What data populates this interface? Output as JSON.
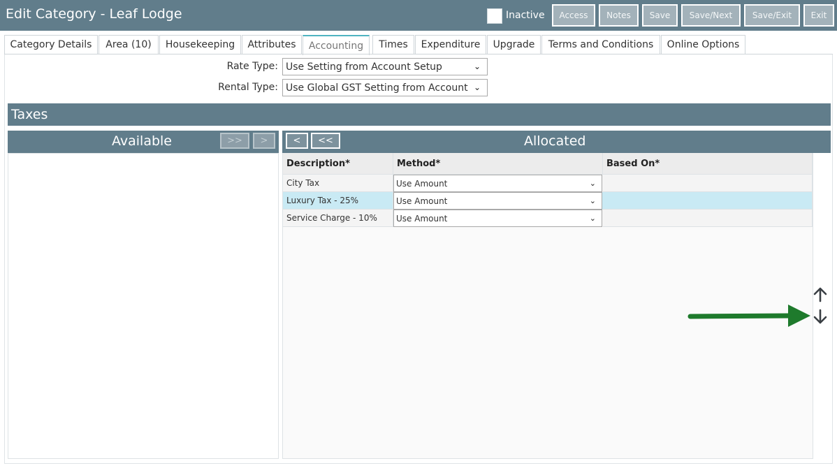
{
  "header": {
    "title": "Edit Category - Leaf Lodge",
    "inactive_label": "Inactive",
    "buttons": [
      "Access",
      "Notes",
      "Save",
      "Save/Next",
      "Save/Exit",
      "Exit"
    ]
  },
  "tabs": [
    {
      "label": "Category Details"
    },
    {
      "label": "Area (10)"
    },
    {
      "label": "Housekeeping"
    },
    {
      "label": "Attributes"
    },
    {
      "label": "Accounting",
      "active": true
    },
    {
      "label": "Times"
    },
    {
      "label": "Expenditure"
    },
    {
      "label": "Upgrade"
    },
    {
      "label": "Terms and Conditions"
    },
    {
      "label": "Online Options"
    }
  ],
  "form": {
    "rate_type_label": "Rate Type:",
    "rate_type_value": "Use Setting from Account Setup",
    "rental_type_label": "Rental Type:",
    "rental_type_value": "Use Global GST Setting from Account"
  },
  "taxes": {
    "section_title": "Taxes",
    "available_title": "Available",
    "available_buttons": [
      ">>",
      ">"
    ],
    "allocated_title": "Allocated",
    "allocated_buttons": [
      "<",
      "<<"
    ],
    "columns": [
      "Description*",
      "Method*",
      "Based On*"
    ],
    "rows": [
      {
        "description": "City Tax",
        "method": "Use Amount",
        "based_on": ""
      },
      {
        "description": "Luxury Tax - 25%",
        "method": "Use Amount",
        "based_on": "",
        "selected": true
      },
      {
        "description": "Service Charge - 10%",
        "method": "Use Amount",
        "based_on": ""
      }
    ]
  },
  "colors": {
    "header_bg": "#617d8b",
    "selected_row": "#c9eaf4",
    "annotation_arrow": "#1e7a2c"
  },
  "icons": [
    "chevron-down-icon",
    "arrow-up-icon",
    "arrow-down-icon",
    "annotation-arrow"
  ]
}
